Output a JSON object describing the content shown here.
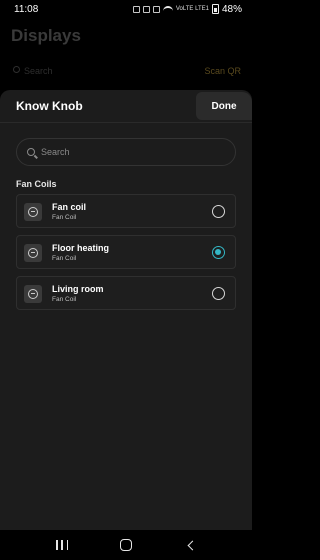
{
  "status_bar": {
    "time": "11:08",
    "network": "VoLTE LTE1",
    "battery": "48%"
  },
  "background_page": {
    "title": "Displays",
    "search_placeholder": "Search",
    "scan_label": "Scan QR"
  },
  "sheet": {
    "title": "Know Knob",
    "done_label": "Done",
    "search_placeholder": "Search",
    "section_label": "Fan Coils",
    "items": [
      {
        "name": "Fan coil",
        "subtitle": "Fan Coil",
        "selected": false
      },
      {
        "name": "Floor heating",
        "subtitle": "Fan Coil",
        "selected": true
      },
      {
        "name": "Living room",
        "subtitle": "Fan Coil",
        "selected": false
      }
    ]
  },
  "colors": {
    "accent": "#34b8c6",
    "sheet_bg": "#1c1c1c",
    "page_bg": "#000000"
  },
  "icons": {
    "item_thumbnail": "fan-coil-icon",
    "search": "search-icon"
  }
}
